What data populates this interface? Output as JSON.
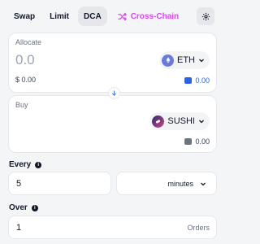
{
  "tabs": [
    {
      "label": "Swap",
      "active": false
    },
    {
      "label": "Limit",
      "active": false
    },
    {
      "label": "DCA",
      "active": true
    },
    {
      "label": "Cross-Chain",
      "active": false
    }
  ],
  "colors": {
    "cross_chain": "#d946ef",
    "accent_blue": "#2563eb",
    "eth": "#6a7bdc"
  },
  "allocate": {
    "label": "Allocate",
    "amount_placeholder": "0.0",
    "token": {
      "symbol": "ETH",
      "icon": "eth-icon"
    },
    "usd_value": "$ 0.00",
    "balance": "0.00"
  },
  "buy": {
    "label": "Buy",
    "token": {
      "symbol": "SUSHI",
      "icon": "sushi-icon"
    },
    "balance": "0.00"
  },
  "every": {
    "label": "Every",
    "value": "5",
    "unit": "minutes"
  },
  "over": {
    "label": "Over",
    "value": "1",
    "suffix": "Orders"
  }
}
